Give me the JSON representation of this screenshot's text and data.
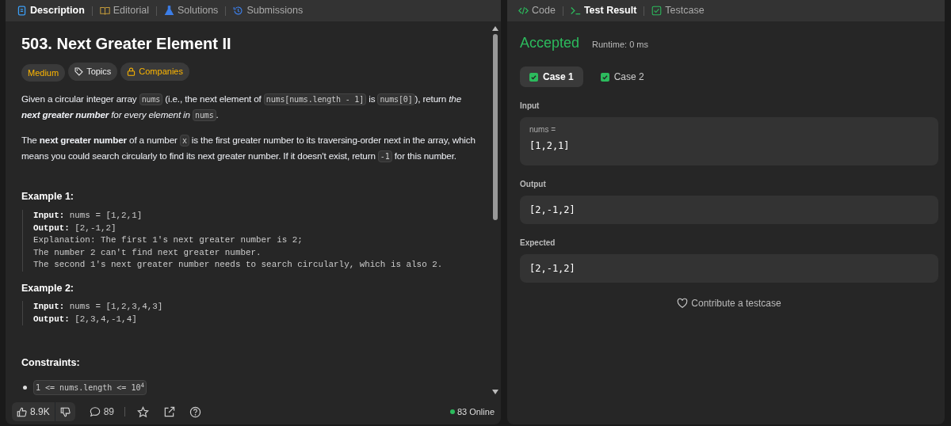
{
  "left_panel": {
    "tabs": [
      {
        "label": "Description",
        "selected": true
      },
      {
        "label": "Editorial",
        "selected": false
      },
      {
        "label": "Solutions",
        "selected": false
      },
      {
        "label": "Submissions",
        "selected": false
      }
    ]
  },
  "problem": {
    "title": "503. Next Greater Element II",
    "tags": [
      {
        "label": "Medium",
        "kind": "difficulty"
      },
      {
        "label": "Topics",
        "kind": "topics"
      },
      {
        "label": "Companies",
        "kind": "companies"
      }
    ],
    "paragraphs": [
      [
        {
          "kind": "text",
          "text": "Given a circular integer array "
        },
        {
          "kind": "code",
          "text": "nums"
        },
        {
          "kind": "text",
          "text": " (i.e., the next element of "
        },
        {
          "kind": "code",
          "text": "nums[nums.length - 1]"
        },
        {
          "kind": "text",
          "text": " is "
        },
        {
          "kind": "code",
          "text": "nums[0]"
        },
        {
          "kind": "text",
          "text": "), return "
        },
        {
          "kind": "em",
          "text": "the **next greater number** for every element in "
        },
        {
          "kind": "code",
          "text": "nums"
        },
        {
          "kind": "text",
          "text": "."
        }
      ],
      [
        {
          "kind": "text",
          "text": "The **next greater number** of a number "
        },
        {
          "kind": "code",
          "text": "x"
        },
        {
          "kind": "text",
          "text": " is the first greater number to its traversing-order next in the array, which means you could search circularly to find its next greater number. If it doesn't exist, return "
        },
        {
          "kind": "code",
          "text": "-1"
        },
        {
          "kind": "text",
          "text": " for this number."
        }
      ]
    ],
    "examples": [
      {
        "heading": "Example 1:",
        "lines": [
          {
            "label": "Input:",
            "text": "nums = [1,2,1]"
          },
          {
            "label": "Output:",
            "text": "[2,-1,2]"
          },
          {
            "text": "Explanation: The first 1's next greater number is 2;"
          },
          {
            "text": "The number 2 can't find next greater number."
          },
          {
            "text": "The second 1's next greater number needs to search circularly, which is also 2."
          }
        ]
      },
      {
        "heading": "Example 2:",
        "lines": [
          {
            "label": "Input:",
            "text": "nums = [1,2,3,4,3]"
          },
          {
            "label": "Output:",
            "text": "[2,3,4,-1,4]"
          }
        ]
      }
    ],
    "constraints_heading": "Constraints:",
    "constraints": [
      "1 <= nums.length <= 10$^{4}$"
    ]
  },
  "footer": {
    "likes": "8.9K",
    "comments": "89",
    "online": "83 Online"
  },
  "right_panel": {
    "tabs": [
      {
        "label": "Code",
        "selected": false
      },
      {
        "label": "Test Result",
        "selected": true
      },
      {
        "label": "Testcase",
        "selected": false
      }
    ],
    "status": "Accepted",
    "runtime": "Runtime: 0 ms",
    "cases": [
      {
        "label": "Case 1",
        "selected": true,
        "passed": true
      },
      {
        "label": "Case 2",
        "selected": false,
        "passed": true
      }
    ],
    "input_label": "Input",
    "inputs": [
      {
        "name": "nums =",
        "value": "[1,2,1]"
      }
    ],
    "output_label": "Output",
    "output": "[2,-1,2]",
    "expected_label": "Expected",
    "expected": "[2,-1,2]",
    "contribute": "Contribute a testcase"
  }
}
